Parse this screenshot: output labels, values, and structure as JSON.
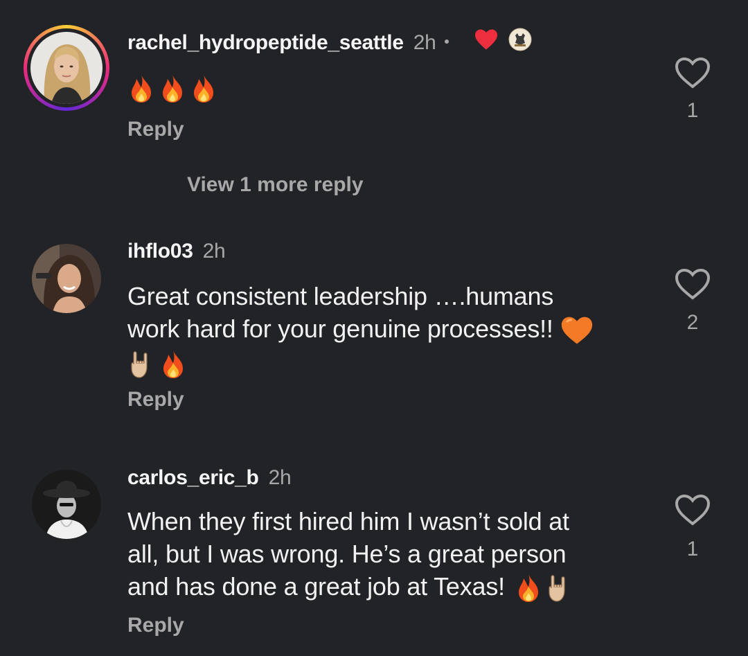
{
  "comments": [
    {
      "username": "rachel_hydropeptide_seattle",
      "time": "2h",
      "text": "",
      "emojis": [
        "fire",
        "fire",
        "fire"
      ],
      "reply_label": "Reply",
      "like_count": "1",
      "creator_liked": true,
      "view_more": "View 1 more reply"
    },
    {
      "username": "ihflo03",
      "time": "2h",
      "text_line1": "Great consistent leadership ….humans",
      "text_line2": "work hard for your genuine processes!!",
      "emojis": [
        "orange-heart",
        "rock-on-hand",
        "fire"
      ],
      "reply_label": "Reply",
      "like_count": "2"
    },
    {
      "username": "carlos_eric_b",
      "time": "2h",
      "text_line1": "When they first hired him I wasn’t sold at",
      "text_line2": "all, but I was wrong. He’s a great person",
      "text_line3": "and has done a great job at Texas!",
      "emojis": [
        "fire",
        "rock-on-hand"
      ],
      "reply_label": "Reply",
      "like_count": "1"
    }
  ],
  "colors": {
    "background": "#222327",
    "text": "#f2f2f2",
    "muted": "#a8a8a8",
    "heart_red": "#ed2e3f"
  }
}
